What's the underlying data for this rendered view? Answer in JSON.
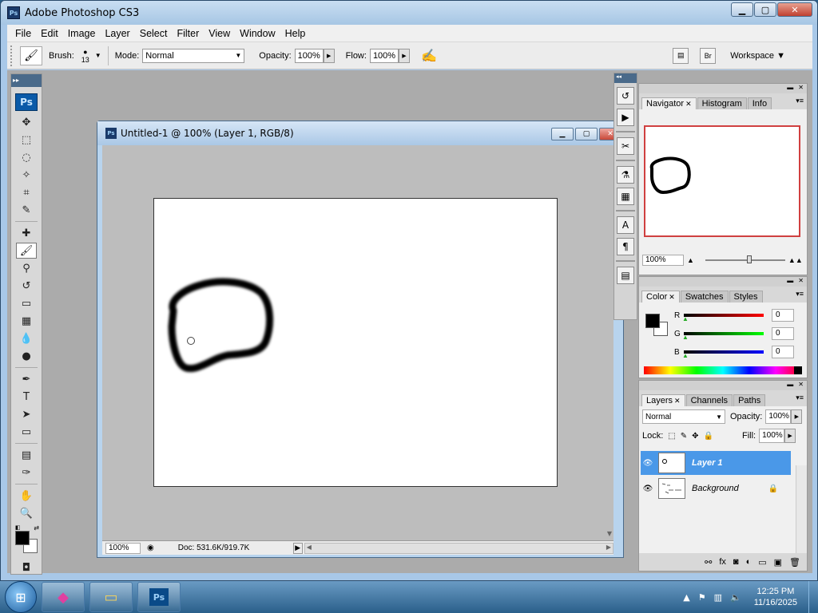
{
  "window": {
    "app_icon": "Ps",
    "title": "Adobe Photoshop CS3",
    "controls": {
      "minimize": "▁",
      "maximize": "▢",
      "close": "✕"
    }
  },
  "menu": [
    "File",
    "Edit",
    "Image",
    "Layer",
    "Select",
    "Filter",
    "View",
    "Window",
    "Help"
  ],
  "options": {
    "brush_label": "Brush:",
    "brush_size": "13",
    "mode_label": "Mode:",
    "mode_value": "Normal",
    "opacity_label": "Opacity:",
    "opacity_value": "100%",
    "flow_label": "Flow:",
    "flow_value": "100%",
    "workspace_label": "Workspace ▼"
  },
  "tools_badge": "Ps",
  "tools": [
    {
      "name": "move-tool-icon",
      "glyph": "✥"
    },
    {
      "name": "marquee-tool-icon",
      "glyph": "⬚"
    },
    {
      "name": "lasso-tool-icon",
      "glyph": "◌"
    },
    {
      "name": "magic-wand-tool-icon",
      "glyph": "✧"
    },
    {
      "name": "crop-tool-icon",
      "glyph": "⌗"
    },
    {
      "name": "slice-tool-icon",
      "glyph": "✎"
    },
    {
      "name": "healing-brush-tool-icon",
      "glyph": "✚"
    },
    {
      "name": "brush-tool-icon",
      "glyph": "🖌",
      "active": true
    },
    {
      "name": "clone-stamp-tool-icon",
      "glyph": "⚲"
    },
    {
      "name": "history-brush-tool-icon",
      "glyph": "↺"
    },
    {
      "name": "eraser-tool-icon",
      "glyph": "▭"
    },
    {
      "name": "gradient-tool-icon",
      "glyph": "▦"
    },
    {
      "name": "blur-tool-icon",
      "glyph": "💧"
    },
    {
      "name": "dodge-tool-icon",
      "glyph": "●"
    },
    {
      "name": "pen-tool-icon",
      "glyph": "✒"
    },
    {
      "name": "type-tool-icon",
      "glyph": "T"
    },
    {
      "name": "path-selection-tool-icon",
      "glyph": "➤"
    },
    {
      "name": "shape-tool-icon",
      "glyph": "▭"
    },
    {
      "name": "notes-tool-icon",
      "glyph": "▤"
    },
    {
      "name": "eyedropper-tool-icon",
      "glyph": "✑"
    },
    {
      "name": "hand-tool-icon",
      "glyph": "✋"
    },
    {
      "name": "zoom-tool-icon",
      "glyph": "🔍"
    }
  ],
  "document": {
    "app_icon": "Ps",
    "title": "Untitled-1 @ 100% (Layer 1, RGB/8)",
    "zoom": "100%",
    "doc_info": "Doc: 531.6K/919.7K"
  },
  "navigator": {
    "tabs": [
      "Navigator",
      "Histogram",
      "Info"
    ],
    "zoom": "100%"
  },
  "color": {
    "tabs": [
      "Color",
      "Swatches",
      "Styles"
    ],
    "channels": [
      {
        "label": "R",
        "value": "0",
        "gradient": "linear-gradient(to right,#000,#f00)"
      },
      {
        "label": "G",
        "value": "0",
        "gradient": "linear-gradient(to right,#000,#0f0)"
      },
      {
        "label": "B",
        "value": "0",
        "gradient": "linear-gradient(to right,#000,#00f)"
      }
    ]
  },
  "layers": {
    "tabs": [
      "Layers",
      "Channels",
      "Paths"
    ],
    "blend_mode": "Normal",
    "opacity_label": "Opacity:",
    "opacity_value": "100%",
    "lock_label": "Lock:",
    "fill_label": "Fill:",
    "fill_value": "100%",
    "items": [
      {
        "name": "Layer 1",
        "active": true
      },
      {
        "name": "Background",
        "active": false,
        "locked": true
      }
    ]
  },
  "taskbar": {
    "time": "12:25 PM",
    "date": "11/16/2025",
    "ps_icon": "Ps"
  }
}
